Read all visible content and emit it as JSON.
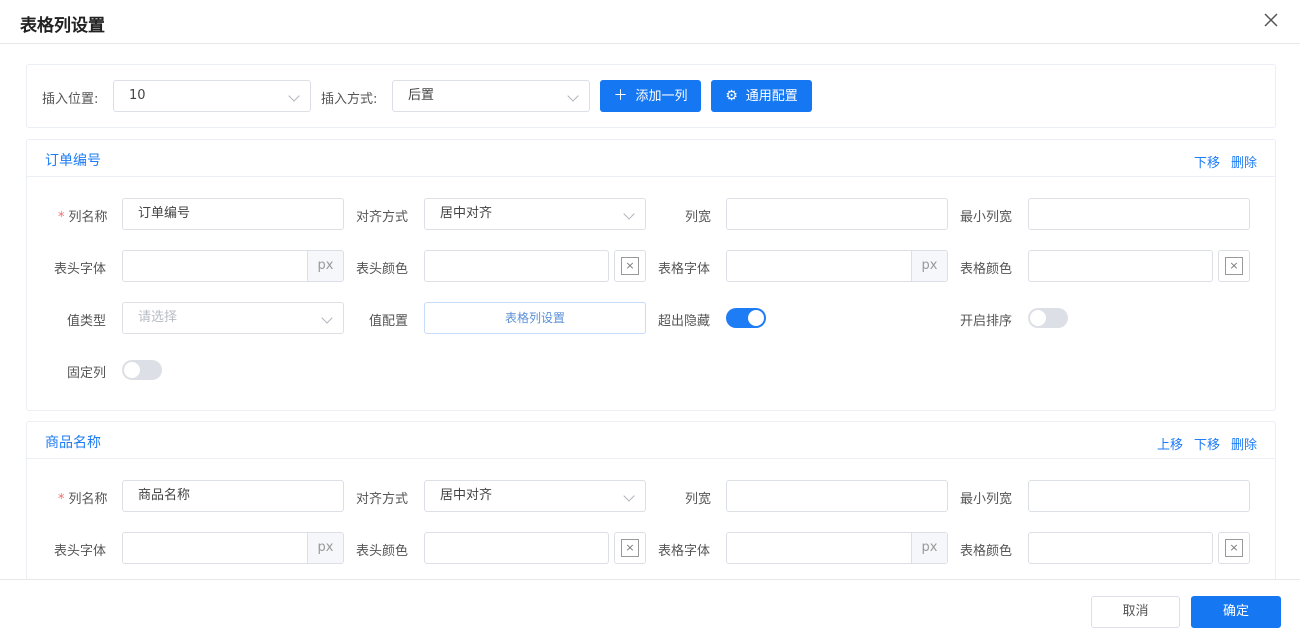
{
  "dialog": {
    "title": "表格列设置",
    "close_icon": "close-icon"
  },
  "toolbar": {
    "insert_position_label": "插入位置:",
    "insert_position_value": "10",
    "insert_mode_label": "插入方式:",
    "insert_mode_value": "后置",
    "add_column_label": "添加一列",
    "add_column_icon": "plus-icon",
    "common_config_label": "通用配置",
    "common_config_icon": "gear-icon"
  },
  "field_labels": {
    "column_name": "列名称",
    "align": "对齐方式",
    "width": "列宽",
    "min_width": "最小列宽",
    "header_font": "表头字体",
    "header_color": "表头颜色",
    "cell_font": "表格字体",
    "cell_color": "表格颜色",
    "value_type": "值类型",
    "value_config": "值配置",
    "overflow_hide": "超出隐藏",
    "sortable": "开启排序",
    "fixed": "固定列",
    "required_mark": "*",
    "px_suffix": "px",
    "clear_mark": "×"
  },
  "columns": [
    {
      "title": "订单编号",
      "actions": [
        "下移",
        "删除"
      ],
      "column_name": "订单编号",
      "align": "居中对齐",
      "width": "",
      "min_width": "",
      "header_font": "",
      "header_color": "",
      "cell_font": "",
      "cell_color": "",
      "value_type_placeholder": "请选择",
      "value_config_button": "表格列设置",
      "overflow_hide": true,
      "sortable": false,
      "fixed": false
    },
    {
      "title": "商品名称",
      "actions": [
        "上移",
        "下移",
        "删除"
      ],
      "column_name": "商品名称",
      "align": "居中对齐",
      "width": "",
      "min_width": "",
      "header_font": "",
      "header_color": "",
      "cell_font": "",
      "cell_color": ""
    }
  ],
  "footer": {
    "cancel_label": "取消",
    "confirm_label": "确定"
  },
  "colors": {
    "primary": "#1677f2",
    "link": "#1e7cf5",
    "required": "#f56c6c"
  }
}
